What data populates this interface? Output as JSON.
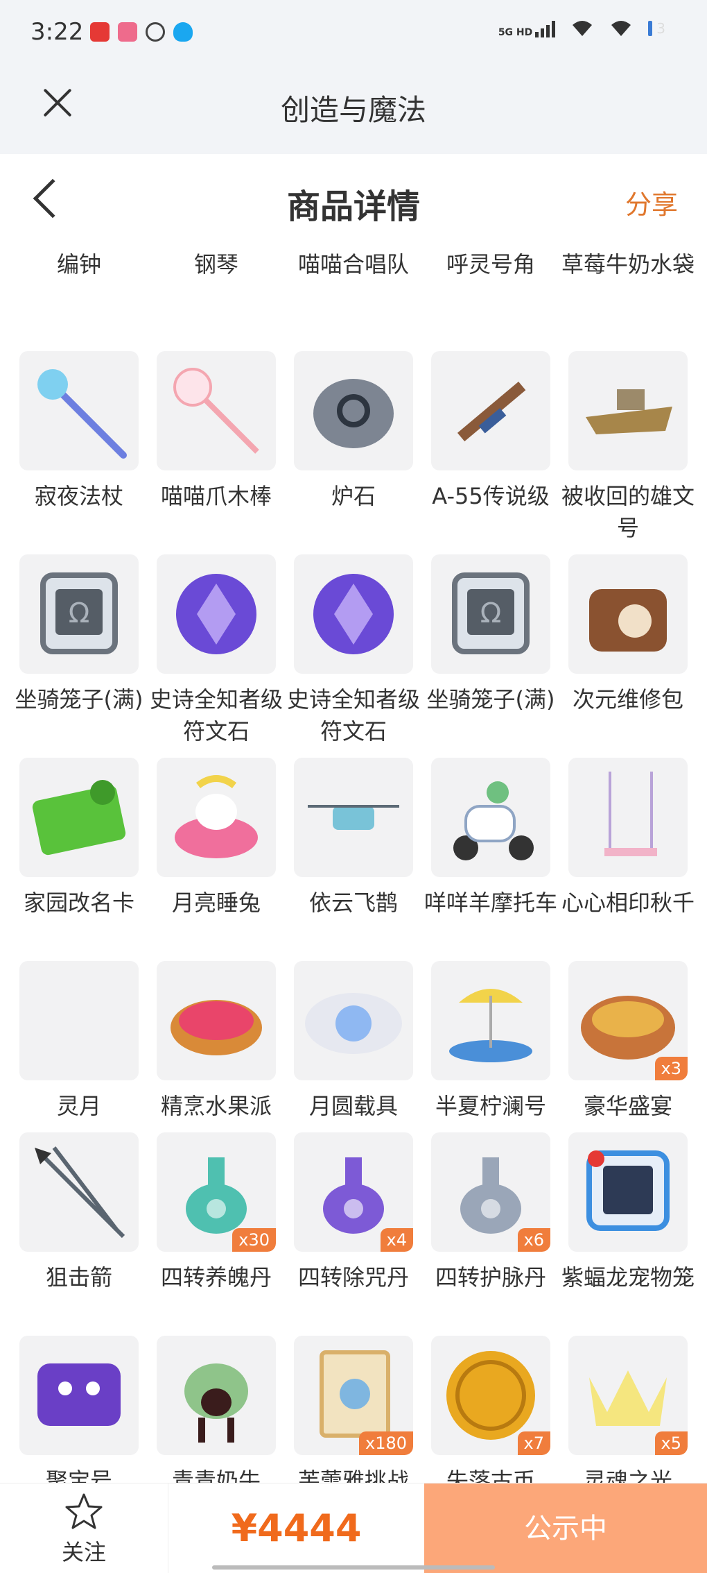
{
  "status_bar": {
    "time": "3:22",
    "network": "5G HD",
    "battery": "3"
  },
  "miniapp_header": {
    "title": "创造与魔法"
  },
  "nav": {
    "title": "商品详情",
    "share": "分享"
  },
  "grid": {
    "rows": [
      [
        {
          "name": "编钟"
        },
        {
          "name": "钢琴"
        },
        {
          "name": "喵喵合唱队"
        },
        {
          "name": "呼灵号角"
        },
        {
          "name": "草莓牛奶水袋"
        }
      ],
      [
        {
          "name": "寂夜法杖",
          "icon": "staff-icon",
          "color": "#6d7fe0"
        },
        {
          "name": "喵喵爪木棒",
          "icon": "paw-wand-icon",
          "color": "#f4a6b0"
        },
        {
          "name": "炉石",
          "icon": "stone-icon",
          "color": "#7d8592"
        },
        {
          "name": "A-55传说级",
          "icon": "rifle-icon",
          "color": "#8a5a3a"
        },
        {
          "name": "被收回的雄文号",
          "icon": "ship-icon",
          "color": "#a7864a"
        }
      ],
      [
        {
          "name": "坐骑笼子(满)",
          "icon": "cage-icon",
          "color": "#6b737d"
        },
        {
          "name": "史诗全知者级符文石",
          "icon": "rune-icon",
          "color": "#6a4ad6"
        },
        {
          "name": "史诗全知者级符文石",
          "icon": "rune-icon",
          "color": "#6a4ad6"
        },
        {
          "name": "坐骑笼子(满)",
          "icon": "cage-icon",
          "color": "#6b737d"
        },
        {
          "name": "次元维修包",
          "icon": "bag-icon",
          "color": "#8a5230"
        }
      ],
      [
        {
          "name": "家园改名卡",
          "icon": "card-icon",
          "color": "#59c23b"
        },
        {
          "name": "月亮睡兔",
          "icon": "rabbit-icon",
          "color": "#f06f9c"
        },
        {
          "name": "依云飞鹊",
          "icon": "drone-icon",
          "color": "#79c3d8"
        },
        {
          "name": "咩咩羊摩托车",
          "icon": "scooter-icon",
          "color": "#8fa5c4"
        },
        {
          "name": "心心相印秋千",
          "icon": "swing-icon",
          "color": "#b9a3d8"
        }
      ],
      [
        {
          "name": "灵月",
          "icon": "moon-icon",
          "color": "#5a7fd8"
        },
        {
          "name": "精烹水果派",
          "icon": "pie-icon",
          "color": "#d98a38"
        },
        {
          "name": "月圆载具",
          "icon": "orb-icon",
          "color": "#8fb8f2"
        },
        {
          "name": "半夏柠澜号",
          "icon": "boat-icon",
          "color": "#f2d34a"
        },
        {
          "name": "豪华盛宴",
          "icon": "feast-icon",
          "color": "#c8743a",
          "qty": "x3"
        }
      ],
      [
        {
          "name": "狙击箭",
          "icon": "arrow-icon",
          "color": "#5a6570"
        },
        {
          "name": "四转养魄丹",
          "icon": "potion-icon",
          "color": "#4fc0b0",
          "qty": "x30"
        },
        {
          "name": "四转除咒丹",
          "icon": "potion-icon",
          "color": "#7d5ad6",
          "qty": "x4"
        },
        {
          "name": "四转护脉丹",
          "icon": "potion-icon",
          "color": "#9aa6b8",
          "qty": "x6"
        },
        {
          "name": "紫蝠龙宠物笼",
          "icon": "pet-cage-icon",
          "color": "#3c8fe0"
        }
      ],
      [
        {
          "name": "聚宝号",
          "icon": "treasure-icon",
          "color": "#6a3fc6"
        },
        {
          "name": "青青奶牛",
          "icon": "cow-icon",
          "color": "#8fc48a"
        },
        {
          "name": "芙蕾雅挑战",
          "icon": "poster-icon",
          "color": "#d9b06a",
          "qty": "x180"
        },
        {
          "name": "失落古币",
          "icon": "coin-icon",
          "color": "#e9a820",
          "qty": "x7"
        },
        {
          "name": "灵魂之光",
          "icon": "crown-icon",
          "color": "#f6e46a",
          "qty": "x5"
        }
      ]
    ]
  },
  "bottom": {
    "follow": "关注",
    "price": "¥4444",
    "action": "公示中"
  }
}
